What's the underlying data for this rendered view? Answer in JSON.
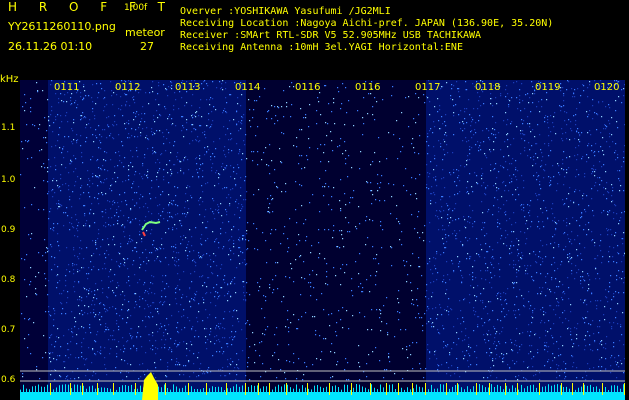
{
  "header": {
    "app_title": "H R O F F T",
    "app_version": "1.00f",
    "file_name": "YY2611260110.png",
    "timestamp": "26.11.26 01:10",
    "meteor_label": "meteor",
    "meteor_count": "27"
  },
  "info": {
    "observer": "Overver              :YOSHIKAWA Yasufumi /JG2MLI",
    "location": "Receiving Location :Nagoya Aichi-pref. JAPAN (136.90E, 35.20N)",
    "receiver": "Receiver            :SMArt RTL-SDR V5 52.905MHz USB TACHIKAWA",
    "antenna": "Receiving Antenna  :10mH 3el.YAGI Horizontal:ENE"
  },
  "y_axis": {
    "unit": "kHz",
    "ticks": [
      "1.1",
      "1.0",
      "0.9",
      "0.8",
      "0.7",
      "0.6"
    ]
  },
  "x_axis": {
    "ticks": [
      "0111",
      "0112",
      "0113",
      "0114",
      "0116",
      "0116",
      "0117",
      "0118",
      "0119",
      "0120"
    ]
  },
  "colors": {
    "text": "#ffff00",
    "background": "#000000",
    "noise_dark": "#00004a",
    "noise_bright": "#3a8cff",
    "baseline": "#00e5ff",
    "meteor": "#7fff7f"
  }
}
